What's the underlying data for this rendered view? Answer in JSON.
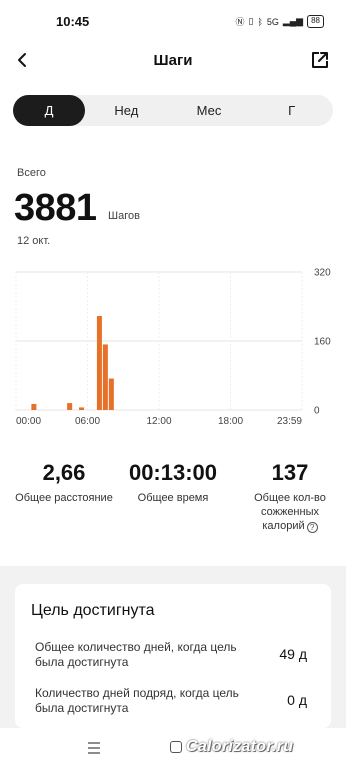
{
  "status": {
    "time": "10:45",
    "network": "5G",
    "battery": "88"
  },
  "header": {
    "title": "Шаги"
  },
  "period_tabs": [
    "Д",
    "Нед",
    "Мес",
    "Г"
  ],
  "summary": {
    "total_label": "Всего",
    "steps": "3881",
    "unit": "Шагов",
    "date": "12 окт."
  },
  "chart_data": {
    "type": "bar",
    "x_ticks": [
      "00:00",
      "06:00",
      "12:00",
      "18:00",
      "23:59"
    ],
    "y_ticks": [
      "320",
      "160",
      "0"
    ],
    "ylim": [
      0,
      320
    ],
    "xlim": [
      0,
      24
    ],
    "bar_color": "#e8712a",
    "bars": [
      {
        "hour": 1.5,
        "value": 14
      },
      {
        "hour": 4.5,
        "value": 16
      },
      {
        "hour": 5.5,
        "value": 6
      },
      {
        "hour": 7.0,
        "value": 218
      },
      {
        "hour": 7.5,
        "value": 152
      },
      {
        "hour": 8.0,
        "value": 73
      }
    ],
    "grid": true
  },
  "stats": [
    {
      "value": "2,66",
      "label": "Общее расстояние"
    },
    {
      "value": "00:13:00",
      "label": "Общее время"
    },
    {
      "value": "137",
      "label": "Общее кол-во сожженных калорий"
    }
  ],
  "goal": {
    "title": "Цель достигнута",
    "rows": [
      {
        "label": "Общее количество дней, когда цель была достигнута",
        "value": "49 д"
      },
      {
        "label": "Количество дней подряд, когда цель была достигнута",
        "value": "0 д"
      }
    ]
  },
  "watermark": "Calorizator.ru"
}
